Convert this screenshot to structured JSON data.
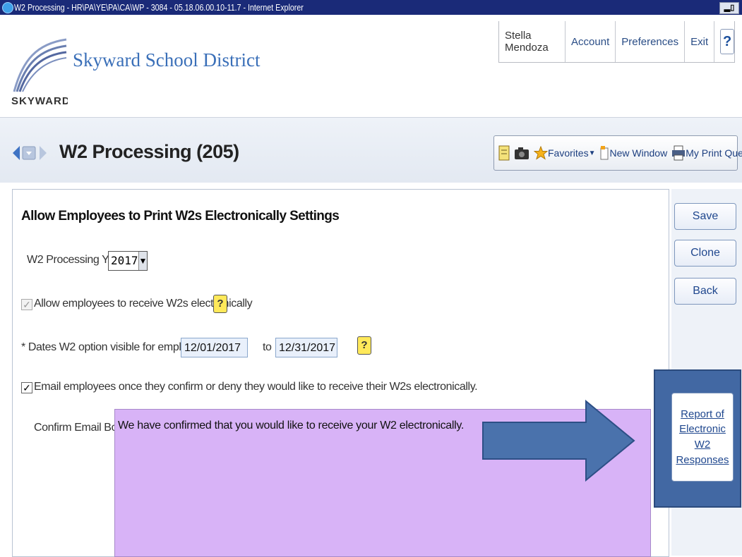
{
  "window": {
    "title": "W2 Processing - HR\\PA\\YE\\PA\\CA\\WP - 3084 - 05.18.06.00.10-11.7 - Internet Explorer"
  },
  "header": {
    "district_name": "Skyward School District",
    "logo_text": "SKYWARD",
    "user_name": "Stella Mendoza",
    "nav": [
      "Account",
      "Preferences",
      "Exit"
    ],
    "help_label": "?"
  },
  "page": {
    "title": "W2 Processing (205)"
  },
  "toolbar": {
    "favorites": "Favorites",
    "new_window": "New Window",
    "print_queue": "My Print Queue"
  },
  "form": {
    "section_title": "Allow Employees to Print W2s Electronically Settings",
    "year_label": "W2 Processing Year:",
    "year_value": "2017",
    "allow_label": "Allow employees to receive W2s electronically",
    "allow_checked": true,
    "dates_label": "* Dates W2 option visible for employees:",
    "date_from": "12/01/2017",
    "to_label": "to",
    "date_to": "12/31/2017",
    "email_label": "Email employees once they confirm or deny they would like to receive their W2s electronically.",
    "email_checked": true,
    "confirm_label": "Confirm Email Body:",
    "confirm_body": "We have confirmed that you would like to receive your W2 electronically.",
    "checkmark": "✓",
    "help_icon": "?"
  },
  "actions": {
    "save": "Save",
    "clone": "Clone",
    "back": "Back",
    "report": "Report of Electronic W2 Responses"
  },
  "colors": {
    "arrow": "#4a72ac",
    "email_body_bg": "#d8b3f7",
    "titlebar": "#1a2a78"
  }
}
